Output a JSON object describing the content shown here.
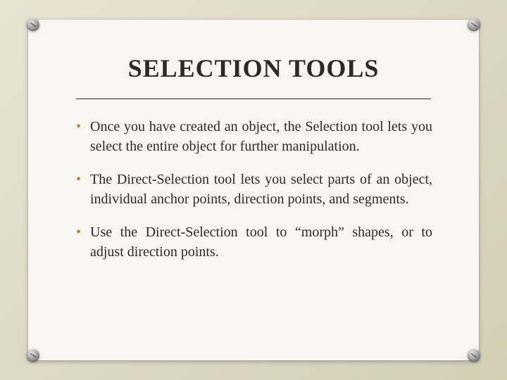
{
  "title": "SELECTION TOOLS",
  "bullets": [
    "Once you have created an object, the Selection tool lets you select the entire object for further manipulation.",
    "The Direct-Selection tool lets you select parts of an object, individual anchor points, direction points, and segments.",
    " Use the Direct-Selection tool to “morph” shapes, or to adjust direction points."
  ],
  "accent_color": "#b08830"
}
